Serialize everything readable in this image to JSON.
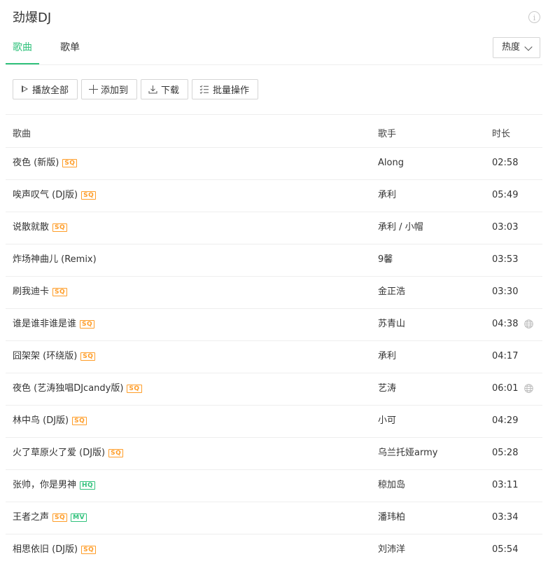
{
  "page": {
    "title": "劲爆DJ"
  },
  "tabs": [
    {
      "label": "歌曲"
    },
    {
      "label": "歌单"
    }
  ],
  "sort": {
    "label": "热度"
  },
  "toolbar": {
    "play_all": "播放全部",
    "add_to": "添加到",
    "download": "下载",
    "batch": "批量操作"
  },
  "columns": {
    "song": "歌曲",
    "singer": "歌手",
    "duration": "时长"
  },
  "songs": [
    {
      "name": "夜色 (新版)",
      "tags": [
        "SQ"
      ],
      "singer": "Along",
      "duration": "02:58",
      "globe": false
    },
    {
      "name": "唉声叹气 (DJ版)",
      "tags": [
        "SQ"
      ],
      "singer": "承利",
      "duration": "05:49",
      "globe": false
    },
    {
      "name": "说散就散",
      "tags": [
        "SQ"
      ],
      "singer": "承利 / 小帽",
      "duration": "03:03",
      "globe": false
    },
    {
      "name": "炸场神曲儿 (Remix)",
      "tags": [],
      "singer": "9馨",
      "duration": "03:53",
      "globe": false
    },
    {
      "name": "刷我迪卡",
      "tags": [
        "SQ"
      ],
      "singer": "金正浩",
      "duration": "03:30",
      "globe": false
    },
    {
      "name": "谁是谁非谁是谁",
      "tags": [
        "SQ"
      ],
      "singer": "苏青山",
      "duration": "04:38",
      "globe": true
    },
    {
      "name": "囧架架 (环绕版)",
      "tags": [
        "SQ"
      ],
      "singer": "承利",
      "duration": "04:17",
      "globe": false
    },
    {
      "name": "夜色 (艺涛独唱DJcandy版)",
      "tags": [
        "SQ"
      ],
      "singer": "艺涛",
      "duration": "06:01",
      "globe": true
    },
    {
      "name": "林中鸟 (DJ版)",
      "tags": [
        "SQ"
      ],
      "singer": "小可",
      "duration": "04:29",
      "globe": false
    },
    {
      "name": "火了草原火了爱 (DJ版)",
      "tags": [
        "SQ"
      ],
      "singer": "乌兰托娅army",
      "duration": "05:28",
      "globe": false
    },
    {
      "name": "张帅，你是男神",
      "tags": [
        "HQ"
      ],
      "singer": "稤加岛",
      "duration": "03:11",
      "globe": false
    },
    {
      "name": "王者之声",
      "tags": [
        "SQ",
        "MV"
      ],
      "singer": "潘玮柏",
      "duration": "03:34",
      "globe": false
    },
    {
      "name": "相思依旧 (DJ版)",
      "tags": [
        "SQ"
      ],
      "singer": "刘沛洋",
      "duration": "05:54",
      "globe": false
    }
  ],
  "colors": {
    "accent": "#31c27c",
    "sq_tag": "#ff9d28",
    "text": "#333333",
    "divider": "#eeeeee"
  }
}
